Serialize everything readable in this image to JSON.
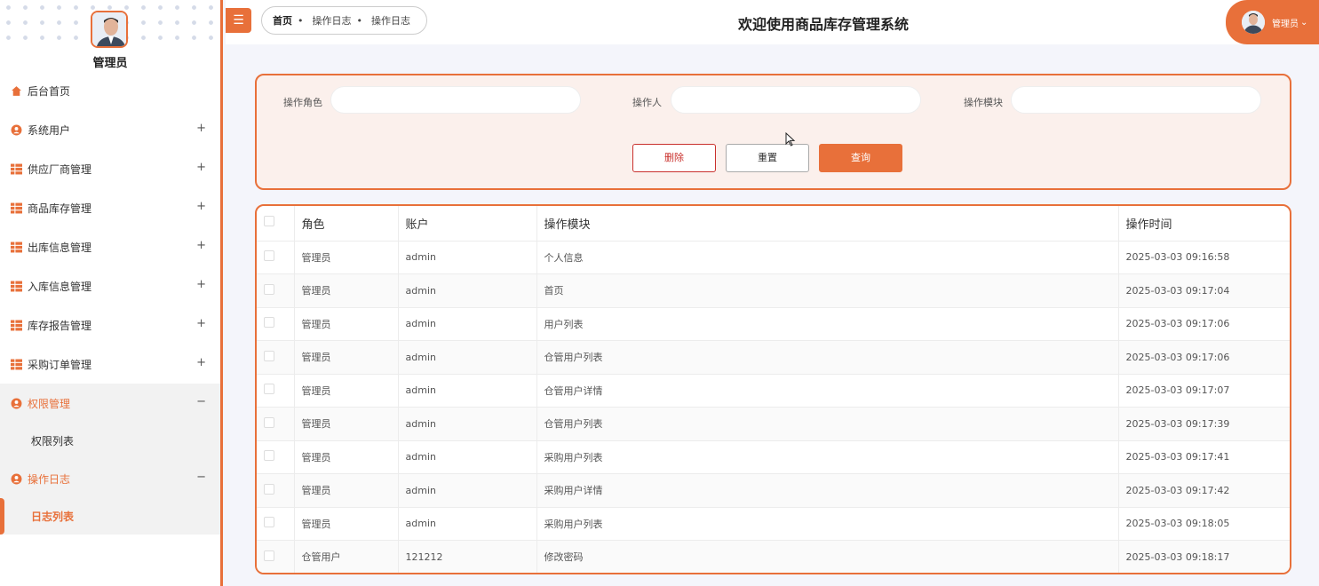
{
  "sidebar": {
    "admin_name": "管理员",
    "items": [
      {
        "label": "后台首页",
        "icon": "home-icon",
        "expand": ""
      },
      {
        "label": "系统用户",
        "icon": "user-icon",
        "expand": "+"
      },
      {
        "label": "供应厂商管理",
        "icon": "grid-icon",
        "expand": "+"
      },
      {
        "label": "商品库存管理",
        "icon": "grid-icon",
        "expand": "+"
      },
      {
        "label": "出库信息管理",
        "icon": "grid-icon",
        "expand": "+"
      },
      {
        "label": "入库信息管理",
        "icon": "grid-icon",
        "expand": "+"
      },
      {
        "label": "库存报告管理",
        "icon": "grid-icon",
        "expand": "+"
      },
      {
        "label": "采购订单管理",
        "icon": "grid-icon",
        "expand": "+"
      },
      {
        "label": "权限管理",
        "icon": "user-icon",
        "expand": "−"
      },
      {
        "label": "权限列表",
        "icon": "",
        "expand": ""
      },
      {
        "label": "操作日志",
        "icon": "user-icon",
        "expand": "−"
      },
      {
        "label": "日志列表",
        "icon": "",
        "expand": ""
      }
    ]
  },
  "header": {
    "menu_icon": "☰",
    "breadcrumb": [
      "首页",
      "操作日志",
      "操作日志"
    ],
    "breadcrumb_sep": "•",
    "title": "欢迎使用商品库存管理系统",
    "user_label": "管理员",
    "user_caret": "⌄"
  },
  "search": {
    "role_label": "操作角色",
    "role_value": "",
    "operator_label": "操作人",
    "operator_value": "",
    "module_label": "操作模块",
    "module_value": "",
    "delete_label": "删除",
    "reset_label": "重置",
    "query_label": "查询"
  },
  "table": {
    "headers": [
      "角色",
      "账户",
      "操作模块",
      "操作时间"
    ],
    "rows": [
      [
        "管理员",
        "admin",
        "个人信息",
        "2025-03-03 09:16:58"
      ],
      [
        "管理员",
        "admin",
        "首页",
        "2025-03-03 09:17:04"
      ],
      [
        "管理员",
        "admin",
        "用户列表",
        "2025-03-03 09:17:06"
      ],
      [
        "管理员",
        "admin",
        "仓管用户列表",
        "2025-03-03 09:17:06"
      ],
      [
        "管理员",
        "admin",
        "仓管用户详情",
        "2025-03-03 09:17:07"
      ],
      [
        "管理员",
        "admin",
        "仓管用户列表",
        "2025-03-03 09:17:39"
      ],
      [
        "管理员",
        "admin",
        "采购用户列表",
        "2025-03-03 09:17:41"
      ],
      [
        "管理员",
        "admin",
        "采购用户详情",
        "2025-03-03 09:17:42"
      ],
      [
        "管理员",
        "admin",
        "采购用户列表",
        "2025-03-03 09:18:05"
      ],
      [
        "仓管用户",
        "121212",
        "修改密码",
        "2025-03-03 09:18:17"
      ]
    ]
  },
  "colors": {
    "accent": "#e8703a",
    "danger": "#c9302c",
    "panel_bg": "#fbf0ec"
  }
}
